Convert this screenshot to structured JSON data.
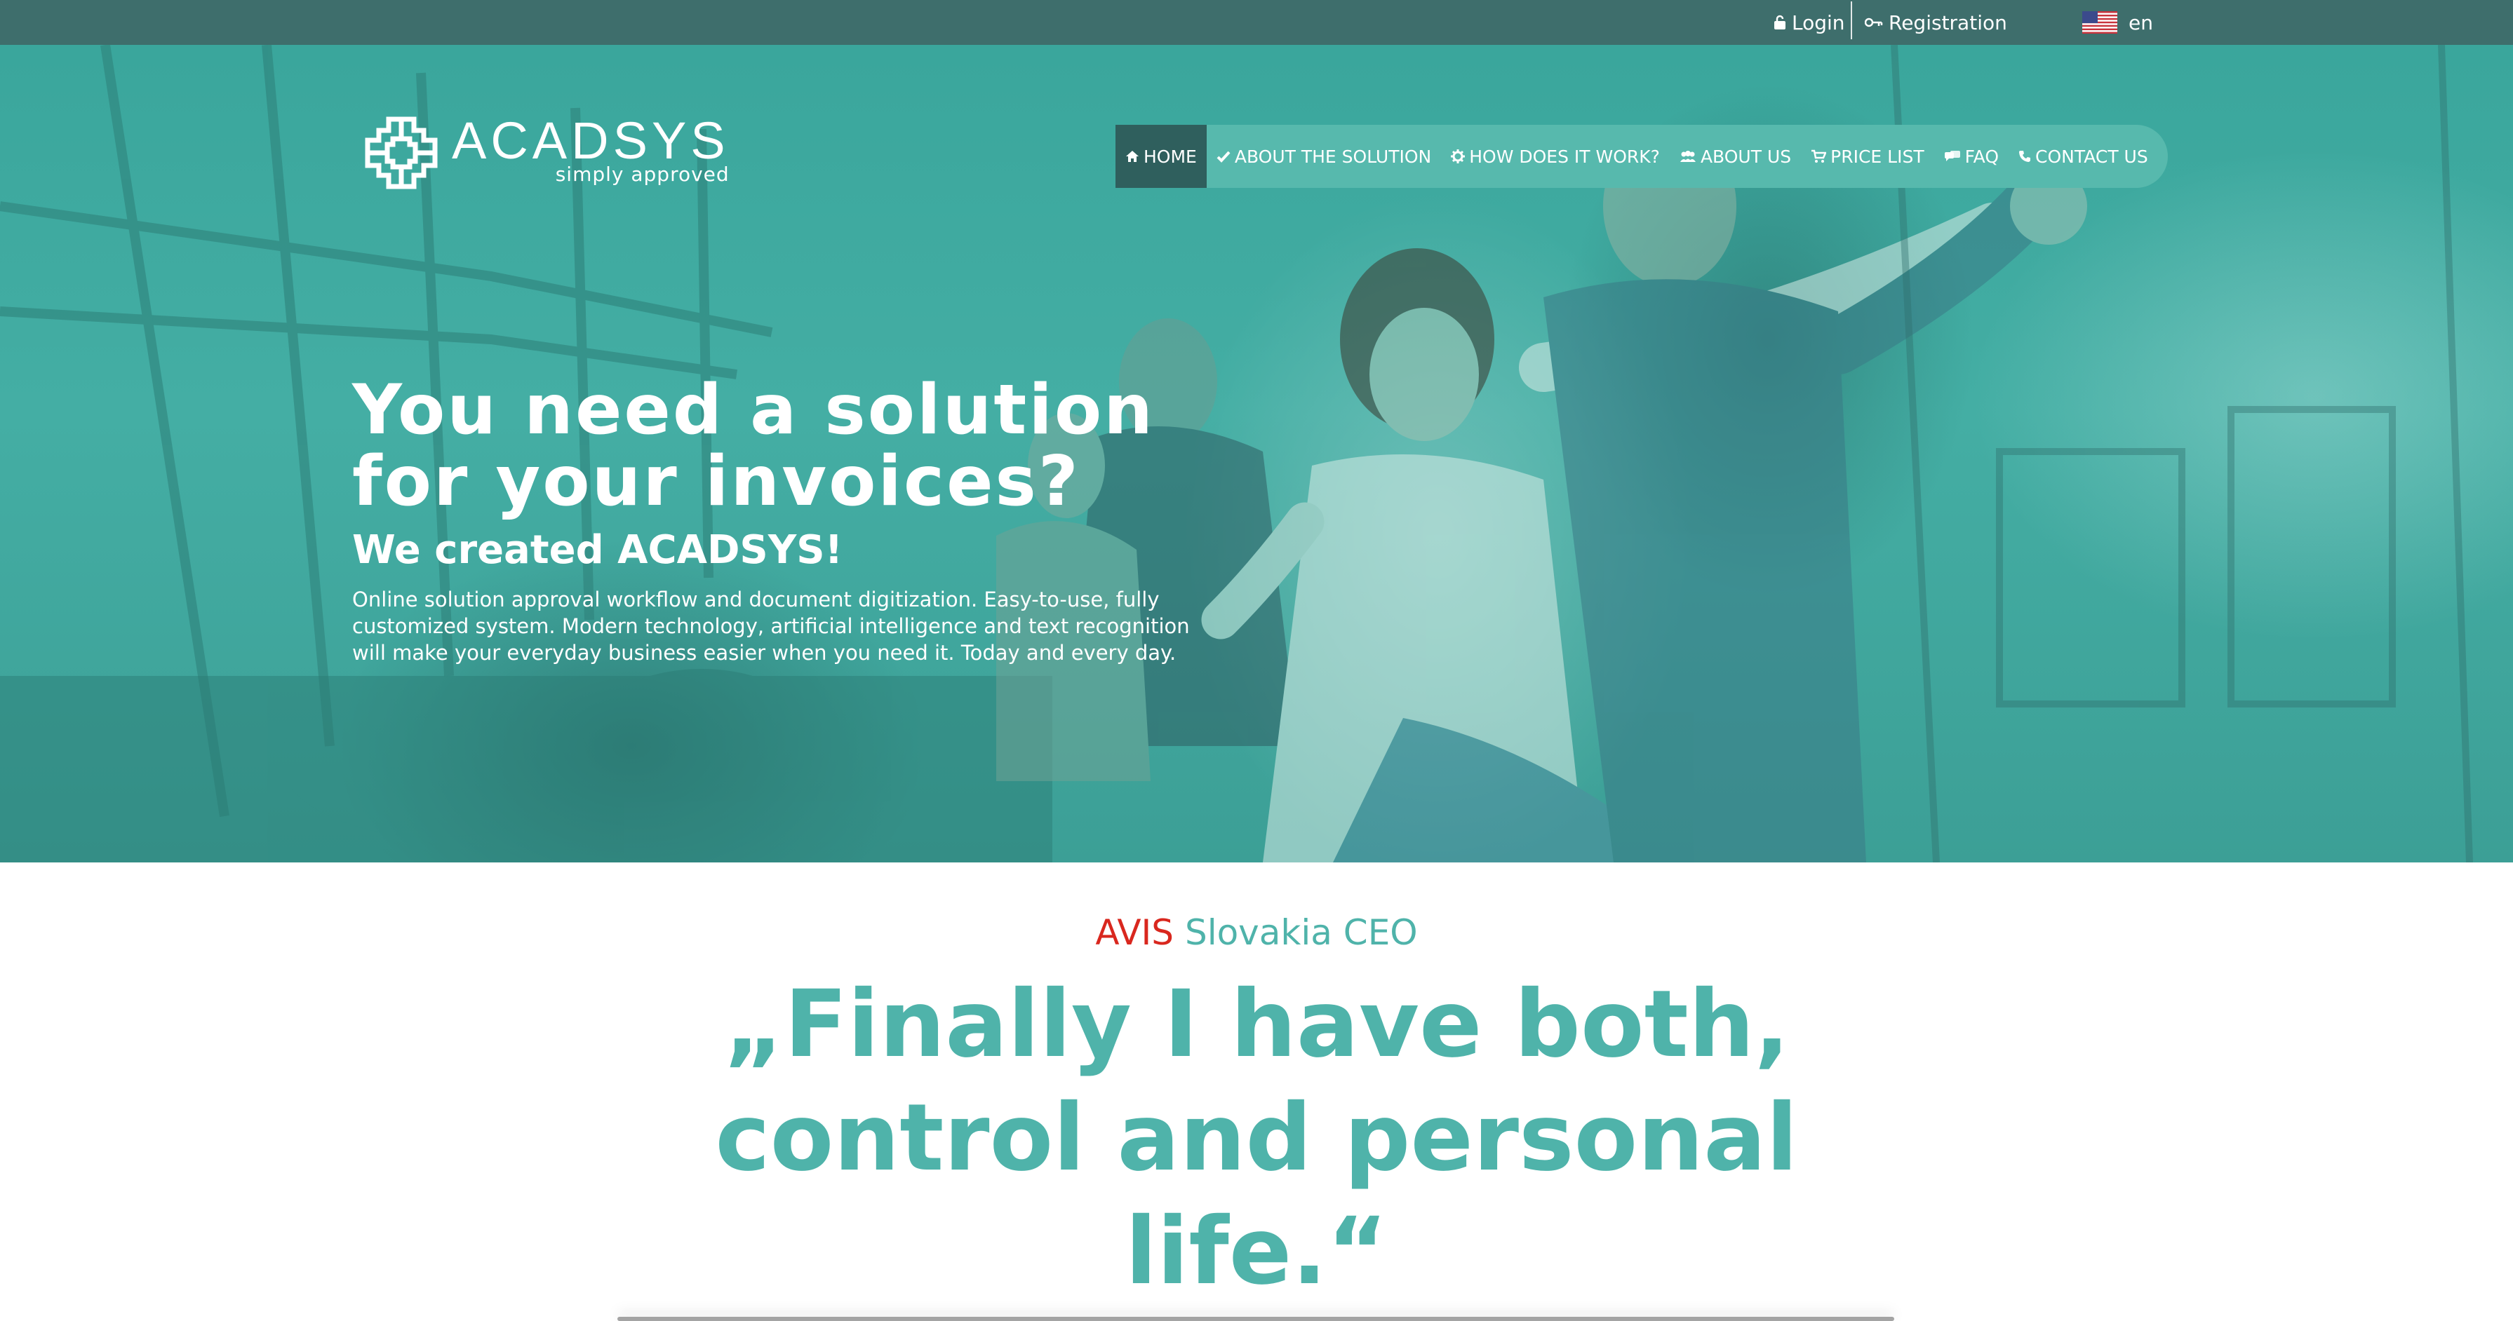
{
  "topbar": {
    "login": "Login",
    "registration": "Registration",
    "language": "en",
    "icons": {
      "login": "lock-icon",
      "registration": "key-icon",
      "language": "us-flag-icon"
    }
  },
  "brand": {
    "name": "ACADSYS",
    "tagline": "simply approved"
  },
  "nav": {
    "items": [
      {
        "label": "HOME",
        "icon": "home-icon",
        "active": true
      },
      {
        "label": "ABOUT THE SOLUTION",
        "icon": "check-icon"
      },
      {
        "label": "HOW DOES IT WORK?",
        "icon": "gear-icon"
      },
      {
        "label": "ABOUT US",
        "icon": "users-icon"
      },
      {
        "label": "PRICE LIST",
        "icon": "cart-icon"
      },
      {
        "label": "FAQ",
        "icon": "chat-icon"
      },
      {
        "label": "CONTACT US",
        "icon": "phone-icon"
      }
    ]
  },
  "hero": {
    "title_line1": "You need a solution",
    "title_line2": "for your invoices?",
    "subtitle": "We created ACADSYS!",
    "description_lines": [
      "Online solution approval workflow and document digitization. Easy-to-use, fully",
      "customized system. Modern technology, artificial intelligence and text recognition",
      "will make your everyday business easier when you need it. Today and every day."
    ]
  },
  "testimonial": {
    "company": "AVIS",
    "role": "Slovakia CEO",
    "quote_lines": [
      "„Finally I have both,",
      "control and personal",
      "life.“"
    ]
  },
  "colors": {
    "topbar": "#3e6e6c",
    "hero_teal": "#44aea4",
    "nav_bg": "#57b9ad",
    "nav_active": "#2f5f5d",
    "quote_teal": "#4fb3aa",
    "company_red": "#d9271e"
  }
}
